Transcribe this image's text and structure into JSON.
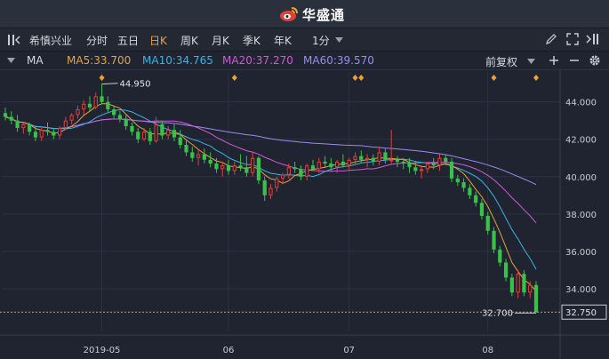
{
  "brand": {
    "name": "华盛通"
  },
  "toolbar": {
    "stock_name": "希慎兴业",
    "periods": [
      "分时",
      "五日",
      "日K",
      "周K",
      "月K",
      "季K",
      "年K"
    ],
    "active_period": "日K",
    "minute_select": "1分"
  },
  "indicator": {
    "name": "MA",
    "ma5": "MA5:33.700",
    "ma10": "MA10:34.765",
    "ma20": "MA20:37.270",
    "ma60": "MA60:39.570",
    "adjust": "前复权"
  },
  "colors": {
    "up": "#e0403a",
    "down": "#38c24a",
    "ma5": "#e8a33a",
    "ma10": "#38b4e8",
    "ma20": "#d05ad8",
    "ma60": "#9a8cf0",
    "accent": "#f0a030"
  },
  "chart_data": {
    "type": "candlestick",
    "y_ticks": [
      "44.000",
      "42.000",
      "40.000",
      "38.000",
      "36.000",
      "34.000"
    ],
    "ylim": [
      32.0,
      45.6
    ],
    "x_labels": [
      {
        "label": "2019-05",
        "index": 16
      },
      {
        "label": "06",
        "index": 37
      },
      {
        "label": "07",
        "index": 57
      },
      {
        "label": "08",
        "index": 80
      }
    ],
    "max_label": "44.950",
    "min_label": "32.700",
    "last_price": "32.750",
    "event_marker_indices": [
      16,
      38,
      58,
      59,
      81,
      88
    ],
    "candles": [
      [
        43.4,
        43.7,
        43.0,
        43.2
      ],
      [
        43.2,
        43.5,
        42.8,
        43.0
      ],
      [
        43.0,
        43.3,
        42.4,
        42.6
      ],
      [
        42.6,
        42.9,
        42.3,
        42.8
      ],
      [
        42.8,
        42.9,
        42.2,
        42.4
      ],
      [
        42.4,
        42.7,
        41.9,
        42.1
      ],
      [
        42.1,
        42.6,
        41.9,
        42.5
      ],
      [
        42.5,
        42.9,
        42.2,
        42.4
      ],
      [
        42.4,
        42.6,
        42.0,
        42.2
      ],
      [
        42.2,
        42.7,
        42.0,
        42.6
      ],
      [
        42.6,
        43.2,
        42.5,
        43.0
      ],
      [
        43.0,
        43.4,
        42.8,
        43.3
      ],
      [
        43.3,
        43.8,
        43.1,
        43.6
      ],
      [
        43.6,
        44.1,
        43.3,
        43.9
      ],
      [
        43.9,
        44.3,
        43.5,
        43.7
      ],
      [
        43.7,
        44.5,
        43.6,
        44.3
      ],
      [
        44.3,
        44.95,
        43.9,
        44.0
      ],
      [
        44.0,
        44.3,
        43.4,
        43.6
      ],
      [
        43.6,
        43.8,
        43.1,
        43.3
      ],
      [
        43.3,
        43.5,
        42.9,
        43.1
      ],
      [
        43.1,
        43.3,
        42.5,
        42.7
      ],
      [
        42.7,
        42.9,
        42.2,
        42.4
      ],
      [
        42.4,
        42.6,
        41.8,
        42.0
      ],
      [
        42.0,
        42.6,
        41.9,
        42.4
      ],
      [
        42.4,
        42.6,
        41.7,
        41.9
      ],
      [
        41.9,
        43.2,
        41.8,
        42.8
      ],
      [
        42.8,
        43.0,
        42.0,
        42.2
      ],
      [
        42.2,
        42.7,
        42.0,
        42.5
      ],
      [
        42.5,
        42.8,
        41.9,
        42.1
      ],
      [
        42.1,
        42.5,
        41.5,
        41.7
      ],
      [
        41.7,
        42.0,
        41.1,
        41.3
      ],
      [
        41.3,
        41.6,
        40.8,
        41.0
      ],
      [
        41.0,
        41.4,
        40.6,
        41.2
      ],
      [
        41.2,
        41.5,
        40.7,
        40.9
      ],
      [
        40.9,
        41.3,
        40.5,
        40.7
      ],
      [
        40.7,
        41.0,
        40.2,
        40.4
      ],
      [
        40.4,
        40.8,
        40.0,
        40.6
      ],
      [
        40.6,
        40.9,
        40.1,
        40.3
      ],
      [
        40.3,
        40.8,
        40.1,
        40.6
      ],
      [
        40.6,
        41.2,
        40.3,
        40.5
      ],
      [
        40.5,
        41.1,
        40.0,
        40.2
      ],
      [
        40.2,
        41.3,
        40.0,
        41.0
      ],
      [
        41.0,
        41.1,
        39.6,
        39.8
      ],
      [
        39.8,
        40.0,
        38.7,
        39.0
      ],
      [
        39.0,
        39.6,
        38.8,
        39.4
      ],
      [
        39.4,
        40.0,
        39.2,
        39.9
      ],
      [
        39.9,
        40.2,
        39.6,
        40.1
      ],
      [
        40.1,
        40.7,
        39.9,
        40.5
      ],
      [
        40.5,
        40.8,
        40.2,
        40.4
      ],
      [
        40.4,
        40.6,
        39.8,
        40.0
      ],
      [
        40.0,
        40.7,
        39.8,
        40.6
      ],
      [
        40.6,
        40.9,
        40.3,
        40.4
      ],
      [
        40.4,
        41.0,
        40.2,
        40.8
      ],
      [
        40.8,
        41.1,
        40.5,
        40.7
      ],
      [
        40.7,
        41.0,
        40.3,
        40.5
      ],
      [
        40.5,
        40.9,
        40.2,
        40.8
      ],
      [
        40.8,
        41.2,
        40.5,
        40.6
      ],
      [
        40.6,
        41.0,
        40.3,
        40.9
      ],
      [
        40.9,
        41.3,
        40.6,
        41.1
      ],
      [
        41.1,
        41.4,
        40.7,
        40.9
      ],
      [
        40.9,
        41.2,
        40.5,
        41.0
      ],
      [
        41.0,
        41.2,
        40.6,
        40.8
      ],
      [
        40.8,
        41.6,
        40.6,
        41.3
      ],
      [
        41.3,
        41.5,
        40.7,
        40.9
      ],
      [
        40.9,
        42.5,
        40.7,
        40.9
      ],
      [
        40.9,
        41.1,
        40.5,
        40.8
      ],
      [
        40.8,
        41.0,
        40.4,
        40.7
      ],
      [
        40.7,
        41.0,
        40.2,
        40.5
      ],
      [
        40.5,
        40.8,
        40.1,
        40.3
      ],
      [
        40.3,
        40.6,
        39.9,
        40.4
      ],
      [
        40.4,
        40.8,
        40.2,
        40.7
      ],
      [
        40.7,
        41.0,
        40.4,
        40.6
      ],
      [
        40.6,
        41.2,
        40.3,
        41.0
      ],
      [
        41.0,
        41.2,
        40.6,
        40.8
      ],
      [
        40.8,
        41.0,
        39.7,
        39.9
      ],
      [
        39.9,
        40.1,
        39.5,
        39.7
      ],
      [
        39.7,
        39.9,
        39.2,
        39.4
      ],
      [
        39.4,
        39.6,
        38.8,
        39.0
      ],
      [
        39.0,
        39.2,
        38.4,
        38.6
      ],
      [
        38.6,
        38.8,
        37.7,
        37.9
      ],
      [
        37.9,
        38.1,
        36.9,
        37.1
      ],
      [
        37.1,
        37.3,
        35.9,
        36.1
      ],
      [
        36.1,
        36.3,
        35.2,
        35.4
      ],
      [
        35.4,
        35.6,
        34.4,
        34.6
      ],
      [
        34.6,
        34.8,
        33.6,
        33.8
      ],
      [
        33.8,
        35.0,
        33.5,
        34.8
      ],
      [
        34.8,
        35.0,
        33.6,
        33.8
      ],
      [
        33.8,
        34.4,
        33.5,
        34.2
      ],
      [
        34.2,
        34.4,
        32.7,
        32.75
      ]
    ]
  }
}
